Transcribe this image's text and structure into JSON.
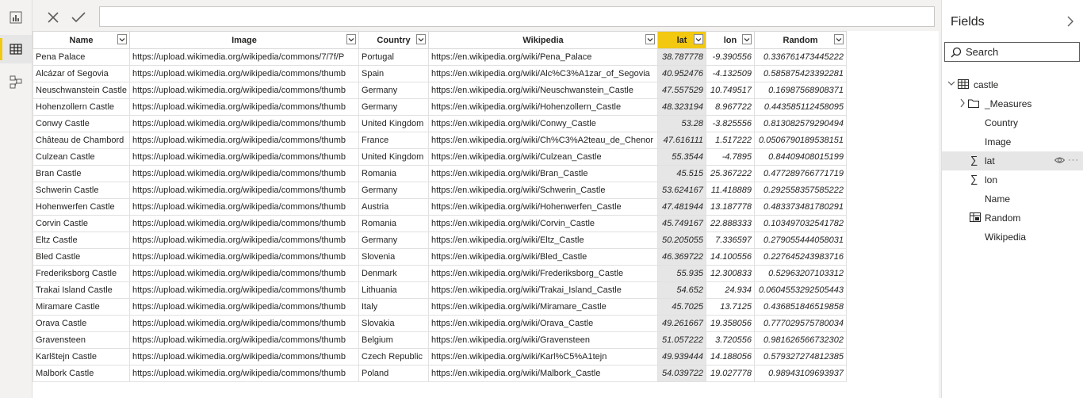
{
  "rail": {
    "items": [
      {
        "name": "report-view-icon"
      },
      {
        "name": "data-view-icon",
        "active": true
      },
      {
        "name": "model-view-icon"
      }
    ]
  },
  "formula": {
    "cancel_icon": "close-icon",
    "commit_icon": "check-icon",
    "value": ""
  },
  "table": {
    "columns": [
      "Name",
      "Image",
      "Country",
      "Wikipedia",
      "lat",
      "lon",
      "Random"
    ],
    "selected_column": "lat",
    "rows": [
      [
        "Pena Palace",
        "https://upload.wikimedia.org/wikipedia/commons/7/7f/P",
        "Portugal",
        "https://en.wikipedia.org/wiki/Pena_Palace",
        "38.787778",
        "-9.390556",
        "0.336761473445222"
      ],
      [
        "Alcázar of Segovia",
        "https://upload.wikimedia.org/wikipedia/commons/thumb",
        "Spain",
        "https://en.wikipedia.org/wiki/Alc%C3%A1zar_of_Segovia",
        "40.952476",
        "-4.132509",
        "0.585875423392281"
      ],
      [
        "Neuschwanstein Castle",
        "https://upload.wikimedia.org/wikipedia/commons/thumb",
        "Germany",
        "https://en.wikipedia.org/wiki/Neuschwanstein_Castle",
        "47.557529",
        "10.749517",
        "0.16987568908371"
      ],
      [
        "Hohenzollern Castle",
        "https://upload.wikimedia.org/wikipedia/commons/thumb",
        "Germany",
        "https://en.wikipedia.org/wiki/Hohenzollern_Castle",
        "48.323194",
        "8.967722",
        "0.443585112458095"
      ],
      [
        "Conwy Castle",
        "https://upload.wikimedia.org/wikipedia/commons/thumb",
        "United Kingdom",
        "https://en.wikipedia.org/wiki/Conwy_Castle",
        "53.28",
        "-3.825556",
        "0.813082579290494"
      ],
      [
        "Château de Chambord",
        "https://upload.wikimedia.org/wikipedia/commons/thumb",
        "France",
        "https://en.wikipedia.org/wiki/Ch%C3%A2teau_de_Chenor",
        "47.616111",
        "1.517222",
        "0.0506790189538151"
      ],
      [
        "Culzean Castle",
        "https://upload.wikimedia.org/wikipedia/commons/thumb",
        "United Kingdom",
        "https://en.wikipedia.org/wiki/Culzean_Castle",
        "55.3544",
        "-4.7895",
        "0.84409408015199"
      ],
      [
        "Bran Castle",
        "https://upload.wikimedia.org/wikipedia/commons/thumb",
        "Romania",
        "https://en.wikipedia.org/wiki/Bran_Castle",
        "45.515",
        "25.367222",
        "0.477289766771719"
      ],
      [
        "Schwerin Castle",
        "https://upload.wikimedia.org/wikipedia/commons/thumb",
        "Germany",
        "https://en.wikipedia.org/wiki/Schwerin_Castle",
        "53.624167",
        "11.418889",
        "0.292558357585222"
      ],
      [
        "Hohenwerfen Castle",
        "https://upload.wikimedia.org/wikipedia/commons/thumb",
        "Austria",
        "https://en.wikipedia.org/wiki/Hohenwerfen_Castle",
        "47.481944",
        "13.187778",
        "0.483373481780291"
      ],
      [
        "Corvin Castle",
        "https://upload.wikimedia.org/wikipedia/commons/thumb",
        "Romania",
        "https://en.wikipedia.org/wiki/Corvin_Castle",
        "45.749167",
        "22.888333",
        "0.103497032541782"
      ],
      [
        "Eltz Castle",
        "https://upload.wikimedia.org/wikipedia/commons/thumb",
        "Germany",
        "https://en.wikipedia.org/wiki/Eltz_Castle",
        "50.205055",
        "7.336597",
        "0.279055444058031"
      ],
      [
        "Bled Castle",
        "https://upload.wikimedia.org/wikipedia/commons/thumb",
        "Slovenia",
        "https://en.wikipedia.org/wiki/Bled_Castle",
        "46.369722",
        "14.100556",
        "0.227645243983716"
      ],
      [
        "Frederiksborg Castle",
        "https://upload.wikimedia.org/wikipedia/commons/thumb",
        "Denmark",
        "https://en.wikipedia.org/wiki/Frederiksborg_Castle",
        "55.935",
        "12.300833",
        "0.52963207103312"
      ],
      [
        "Trakai Island Castle",
        "https://upload.wikimedia.org/wikipedia/commons/thumb",
        "Lithuania",
        "https://en.wikipedia.org/wiki/Trakai_Island_Castle",
        "54.652",
        "24.934",
        "0.0604553292505443"
      ],
      [
        "Miramare Castle",
        "https://upload.wikimedia.org/wikipedia/commons/thumb",
        "Italy",
        "https://en.wikipedia.org/wiki/Miramare_Castle",
        "45.7025",
        "13.7125",
        "0.436851846519858"
      ],
      [
        "Orava Castle",
        "https://upload.wikimedia.org/wikipedia/commons/thumb",
        "Slovakia",
        "https://en.wikipedia.org/wiki/Orava_Castle",
        "49.261667",
        "19.358056",
        "0.777029575780034"
      ],
      [
        "Gravensteen",
        "https://upload.wikimedia.org/wikipedia/commons/thumb",
        "Belgium",
        "https://en.wikipedia.org/wiki/Gravensteen",
        "51.057222",
        "3.720556",
        "0.981626566732302"
      ],
      [
        "Karlštejn Castle",
        "https://upload.wikimedia.org/wikipedia/commons/thumb",
        "Czech Republic",
        "https://en.wikipedia.org/wiki/Karl%C5%A1tejn",
        "49.939444",
        "14.188056",
        "0.579327274812385"
      ],
      [
        "Malbork Castle",
        "https://upload.wikimedia.org/wikipedia/commons/thumb",
        "Poland",
        "https://en.wikipedia.org/wiki/Malbork_Castle",
        "54.039722",
        "19.027778",
        "0.98943109693937"
      ]
    ]
  },
  "fields": {
    "title": "Fields",
    "search_placeholder": "Search",
    "table_name": "castle",
    "items": [
      {
        "label": "_Measures",
        "icon": "folder-icon",
        "expand": true
      },
      {
        "label": "Country",
        "icon": ""
      },
      {
        "label": "Image",
        "icon": ""
      },
      {
        "label": "lat",
        "icon": "sigma-icon",
        "highlight": true
      },
      {
        "label": "lon",
        "icon": "sigma-icon"
      },
      {
        "label": "Name",
        "icon": ""
      },
      {
        "label": "Random",
        "icon": "calculated-table-icon"
      },
      {
        "label": "Wikipedia",
        "icon": ""
      }
    ]
  },
  "colors": {
    "accent": "#f2c811",
    "selected_fill": "#e6e6e6"
  }
}
